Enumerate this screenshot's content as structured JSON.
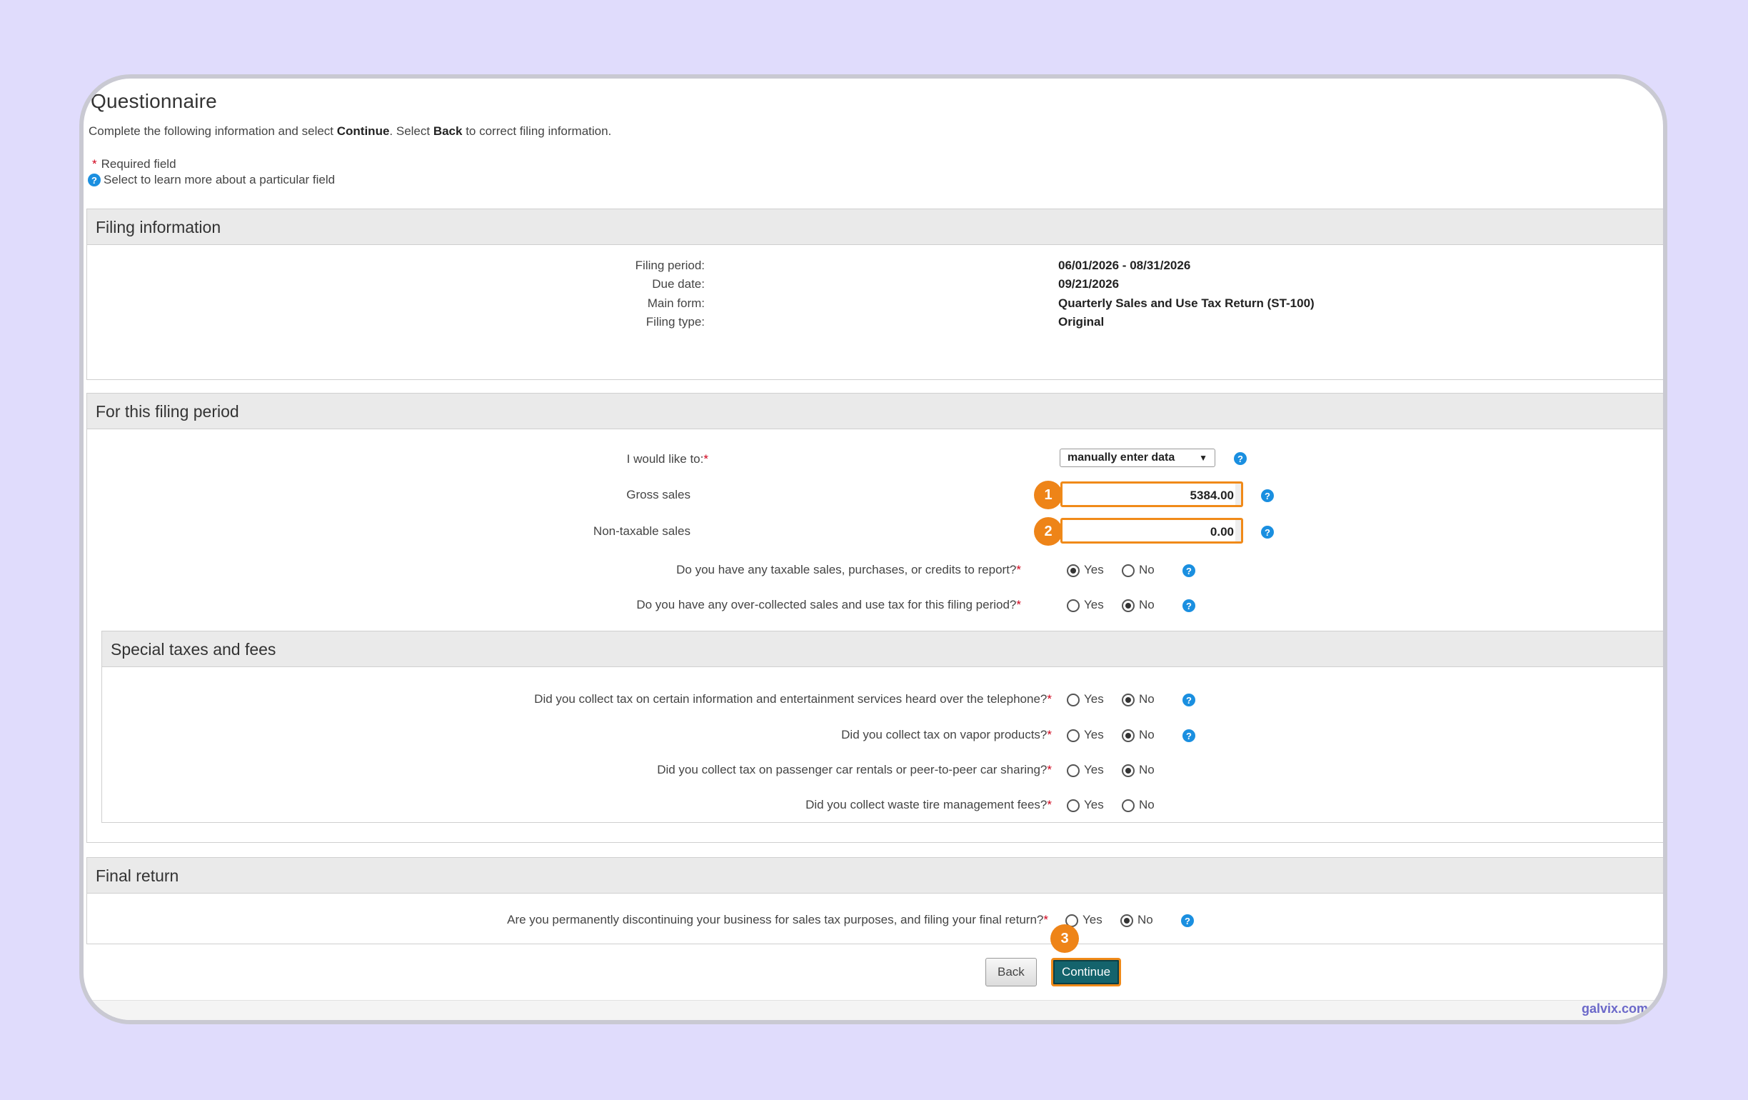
{
  "page": {
    "title": "Questionnaire",
    "intro": {
      "part1": "Complete the following information and select ",
      "continue_word": "Continue",
      "part2": ". Select ",
      "back_word": "Back",
      "part3": " to correct filing information."
    },
    "legend_required": "Required field",
    "legend_help": "Select to learn more about a particular field"
  },
  "filing_information": {
    "heading": "Filing information",
    "rows": [
      {
        "label": "Filing period:",
        "value": "06/01/2026 - 08/31/2026"
      },
      {
        "label": "Due date:",
        "value": "09/21/2026"
      },
      {
        "label": "Main form:",
        "value": "Quarterly Sales and Use Tax Return (ST-100)"
      },
      {
        "label": "Filing type:",
        "value": "Original"
      }
    ]
  },
  "this_period": {
    "heading": "For this filing period",
    "would_like_label": "I would like to:",
    "would_like_value": "manually enter data",
    "gross_sales_label": "Gross sales",
    "gross_sales_value": "5384.00",
    "nontaxable_label": "Non-taxable sales",
    "nontaxable_value": "0.00",
    "q1": "Do you have any taxable sales, purchases, or credits to report?",
    "q2": "Do you have any over-collected sales and use tax for this filing period?"
  },
  "special": {
    "heading": "Special taxes and fees",
    "q1": "Did you collect tax on certain information and entertainment services heard over the telephone?",
    "q2": "Did you collect tax on vapor products?",
    "q3": "Did you collect tax on passenger car rentals or peer-to-peer car sharing?",
    "q4": "Did you collect waste tire management fees?"
  },
  "final_return": {
    "heading": "Final return",
    "q1": "Are you permanently discontinuing your business for sales tax purposes, and filing your final return?"
  },
  "common": {
    "required_mark": "*",
    "help_mark": "?",
    "yes": "Yes",
    "no": "No"
  },
  "answers": {
    "taxable_sales": "Yes",
    "over_collected": "No",
    "telephone_services": "No",
    "vapor_products": "No",
    "car_rentals": "No",
    "waste_tire": "",
    "final_return": "No"
  },
  "badges": [
    "1",
    "2",
    "3"
  ],
  "buttons": {
    "back": "Back",
    "continue": "Continue"
  },
  "brand": "galvix.com",
  "colors": {
    "accent_orange": "#ee8418",
    "continue_bg": "#14636c",
    "help_blue": "#1a8fe0",
    "background": "#e0dcfc"
  }
}
